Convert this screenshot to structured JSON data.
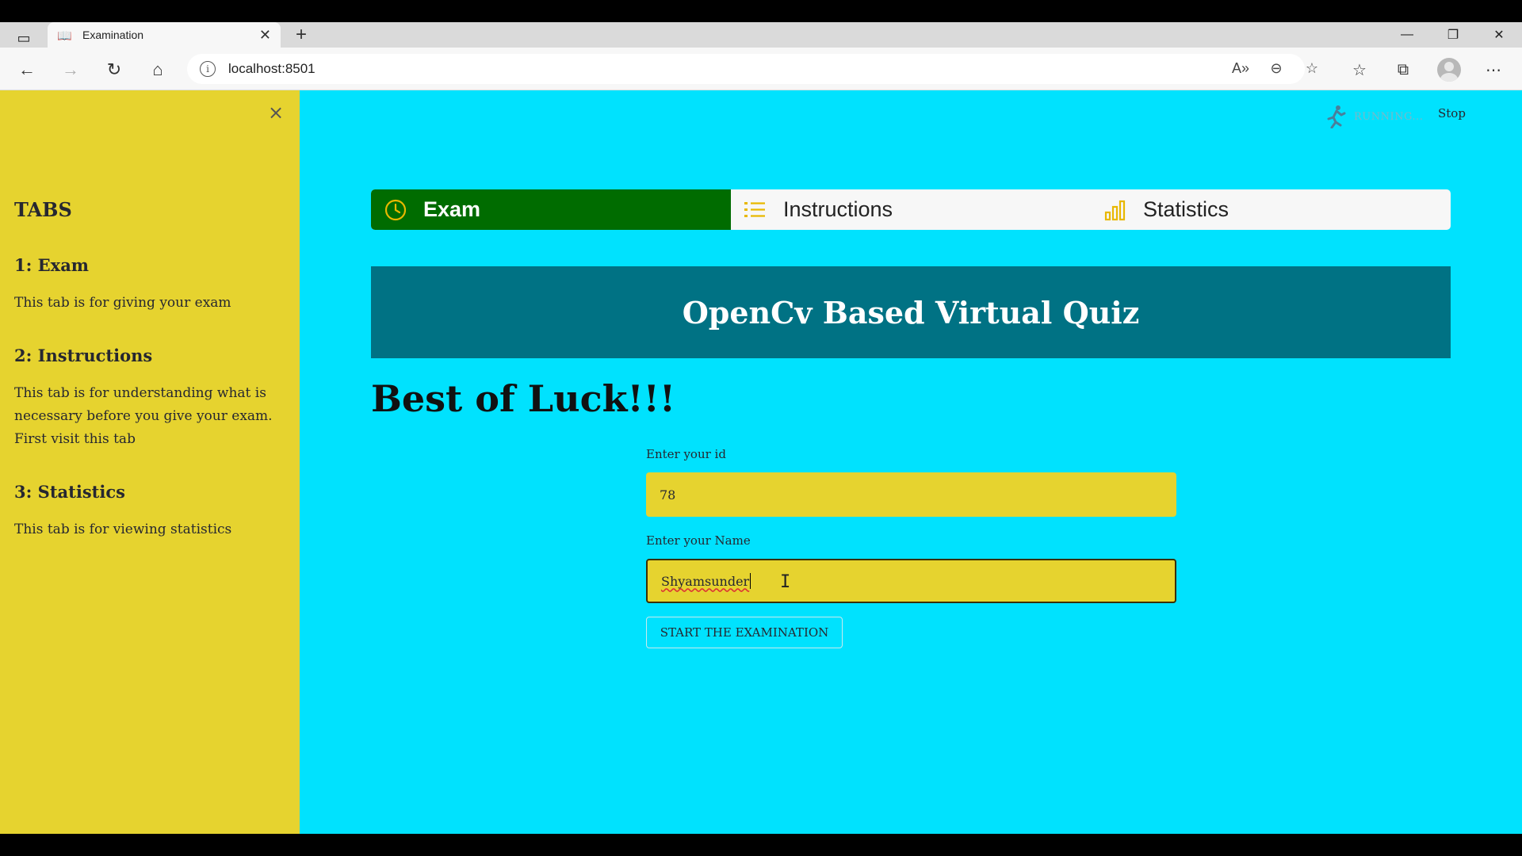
{
  "browser": {
    "tab_title": "Examination",
    "url": "localhost:8501"
  },
  "sidebar": {
    "close_glyph": "×",
    "title": "TABS",
    "sections": [
      {
        "heading": "1: Exam",
        "text": "This tab is for giving your exam"
      },
      {
        "heading": "2: Instructions",
        "text": "This tab is for understanding what is necessary before you give your exam. First visit this tab"
      },
      {
        "heading": "3: Statistics",
        "text": "This tab is for viewing statistics"
      }
    ]
  },
  "status": {
    "running_label": "RUNNING...",
    "stop_label": "Stop"
  },
  "menu": {
    "tabs": [
      {
        "label": "Exam",
        "icon": "clock-icon",
        "active": true
      },
      {
        "label": "Instructions",
        "icon": "list-icon",
        "active": false
      },
      {
        "label": "Statistics",
        "icon": "bar-chart-icon",
        "active": false
      }
    ]
  },
  "main": {
    "banner_title": "OpenCv Based Virtual Quiz",
    "heading": "Best of Luck!!!",
    "id_label": "Enter your id",
    "id_value": "78",
    "name_label": "Enter your Name",
    "name_value": "Shyamsunder",
    "start_button": "START THE EXAMINATION"
  },
  "colors": {
    "sidebar_bg": "#e6d32f",
    "page_bg": "#00e2fe",
    "active_tab": "#006c00",
    "banner_bg": "#007284",
    "icon_accent": "#e8b800"
  }
}
